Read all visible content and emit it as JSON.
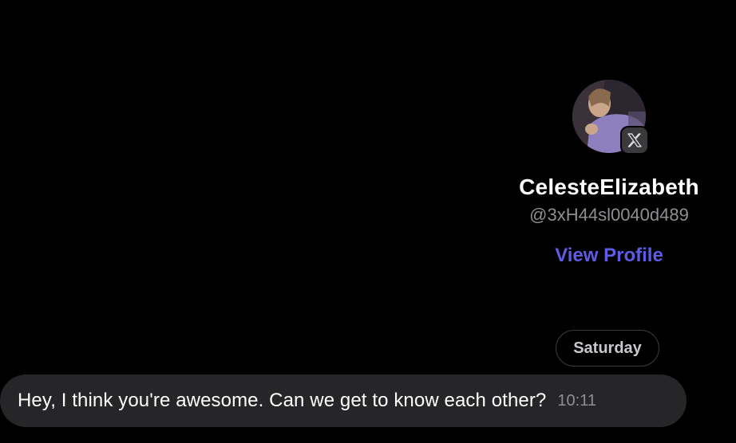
{
  "profile": {
    "display_name": "CelesteElizabeth",
    "handle": "@3xH44sl0040d489",
    "view_profile_label": "View Profile",
    "platform_badge_icon": "x-logo-icon"
  },
  "conversation": {
    "day_separator": "Saturday",
    "messages": [
      {
        "text": "Hey, I think you're awesome. Can we get to know each other?",
        "time": "10:11"
      }
    ]
  },
  "colors": {
    "background": "#000000",
    "link": "#5e5ce6",
    "bubble": "#262628",
    "secondary_text": "#8e8e93"
  }
}
